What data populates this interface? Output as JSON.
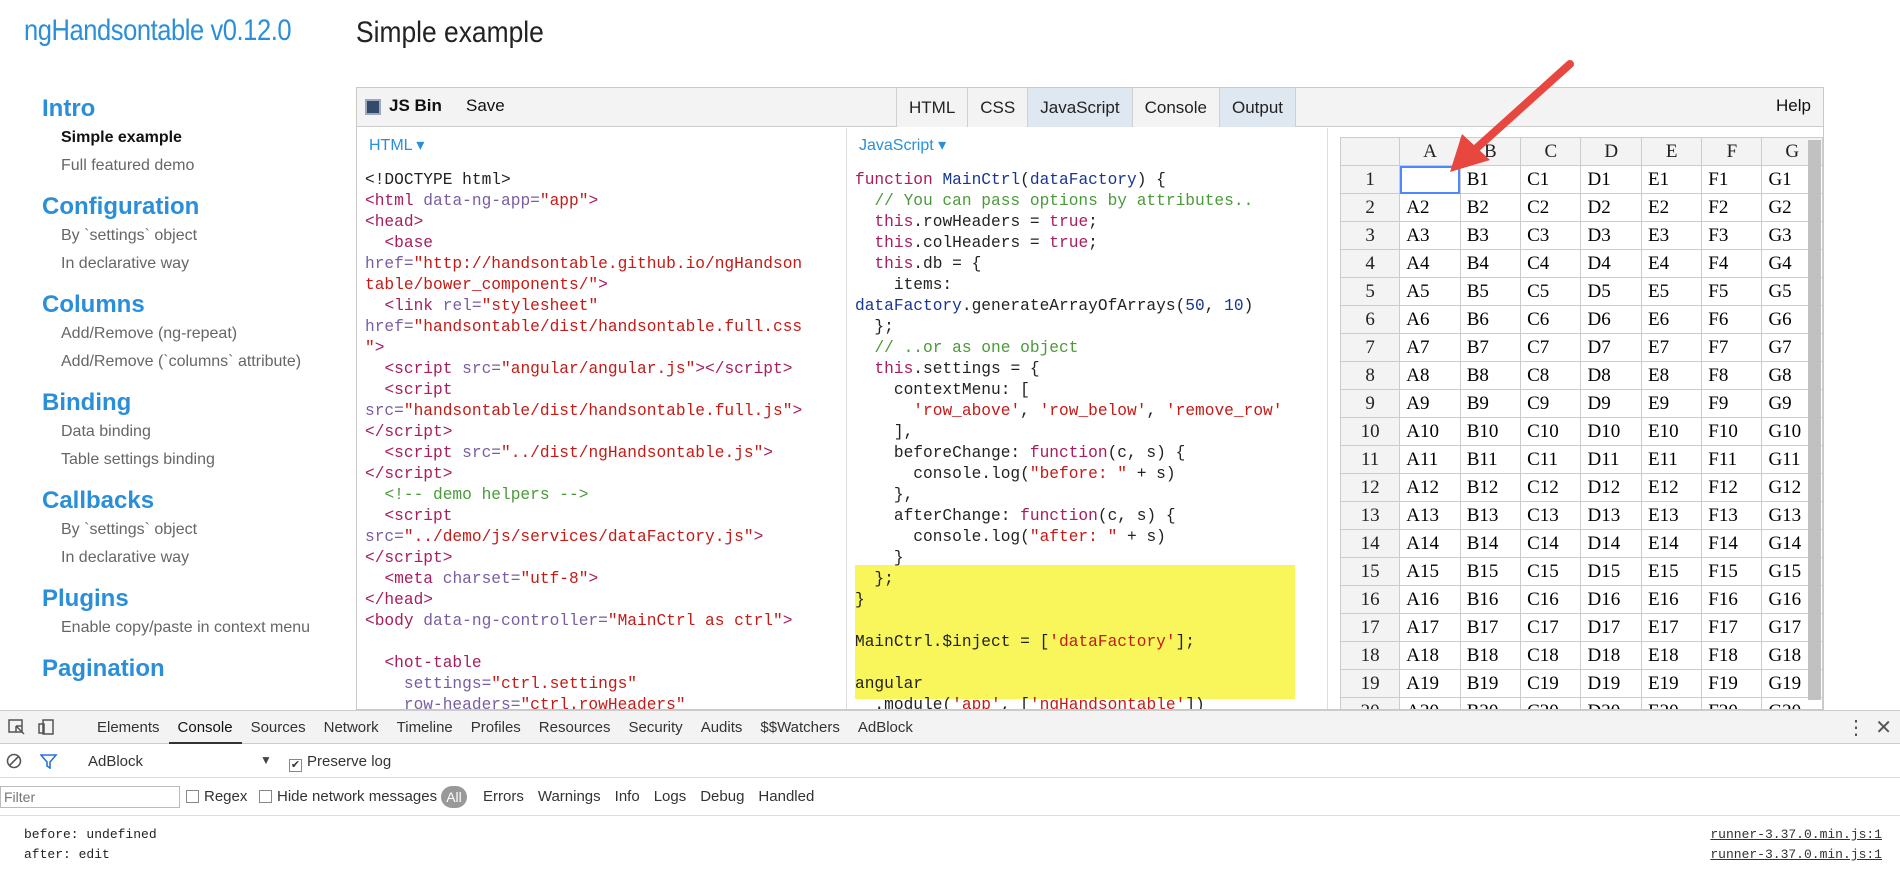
{
  "app_title": "ngHandsontable v0.12.0",
  "page_heading": "Simple example",
  "nav": [
    {
      "heading": "Intro",
      "links": [
        "Simple example",
        "Full featured demo"
      ]
    },
    {
      "heading": "Configuration",
      "links": [
        "By `settings` object",
        "In declarative way"
      ]
    },
    {
      "heading": "Columns",
      "links": [
        "Add/Remove (ng-repeat)",
        "Add/Remove (`columns` attribute)"
      ]
    },
    {
      "heading": "Binding",
      "links": [
        "Data binding",
        "Table settings binding"
      ]
    },
    {
      "heading": "Callbacks",
      "links": [
        "By `settings` object",
        "In declarative way"
      ]
    },
    {
      "heading": "Plugins",
      "links": [
        "Enable copy/paste in context menu"
      ]
    },
    {
      "heading": "Pagination",
      "links": []
    }
  ],
  "jsbin": {
    "name": "JS Bin",
    "save": "Save",
    "tabs": [
      "HTML",
      "CSS",
      "JavaScript",
      "Console",
      "Output"
    ],
    "help": "Help",
    "html_label": "HTML ▾",
    "js_label": "JavaScript ▾"
  },
  "grid": {
    "columns": [
      "A",
      "B",
      "C",
      "D",
      "E",
      "F",
      "G"
    ],
    "rows": 19,
    "partial_row": 20
  },
  "devtools": {
    "tabs": [
      "Elements",
      "Console",
      "Sources",
      "Network",
      "Timeline",
      "Profiles",
      "Resources",
      "Security",
      "Audits",
      "$$Watchers",
      "AdBlock"
    ],
    "context": "AdBlock",
    "preserve_log": "Preserve log",
    "filter_placeholder": "Filter",
    "regex": "Regex",
    "hide_network": "Hide network messages",
    "level_all": "All",
    "levels": [
      "Errors",
      "Warnings",
      "Info",
      "Logs",
      "Debug",
      "Handled"
    ],
    "logs": [
      {
        "text": "before: undefined",
        "source": "runner-3.37.0.min.js:1"
      },
      {
        "text": "after: edit",
        "source": "runner-3.37.0.min.js:1"
      }
    ]
  },
  "colors": {
    "accent": "#2a8fd8",
    "highlight": "#f8f65a",
    "arrow": "#e8473f"
  },
  "icons": [
    "inspect-icon",
    "device-icon",
    "clear-console-icon",
    "filter-icon",
    "more-icon",
    "close-icon",
    "arrow-annotation-icon"
  ]
}
